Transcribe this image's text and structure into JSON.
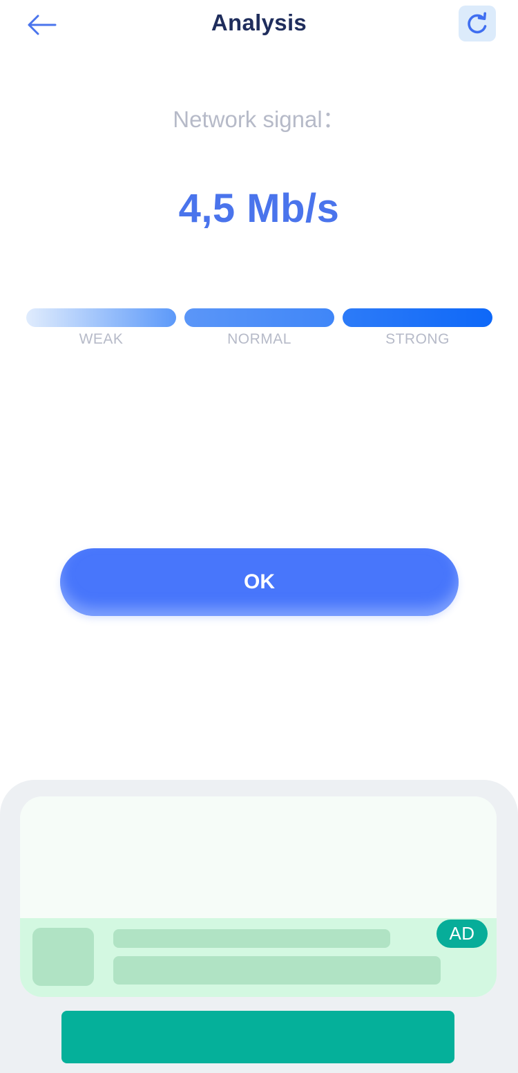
{
  "header": {
    "title": "Analysis",
    "back_icon": "arrow-left-icon",
    "refresh_icon": "refresh-icon"
  },
  "signal": {
    "label": "Network signal：",
    "speed": "4,5 Mb/s",
    "levels": [
      {
        "label": "WEAK"
      },
      {
        "label": "NORMAL"
      },
      {
        "label": "STRONG"
      }
    ]
  },
  "actions": {
    "ok_label": "OK"
  },
  "ad": {
    "badge": "AD"
  },
  "colors": {
    "accent": "#4876fb",
    "title": "#1f2d5c",
    "muted": "#b6bac8",
    "ad_green": "#05b09a"
  }
}
